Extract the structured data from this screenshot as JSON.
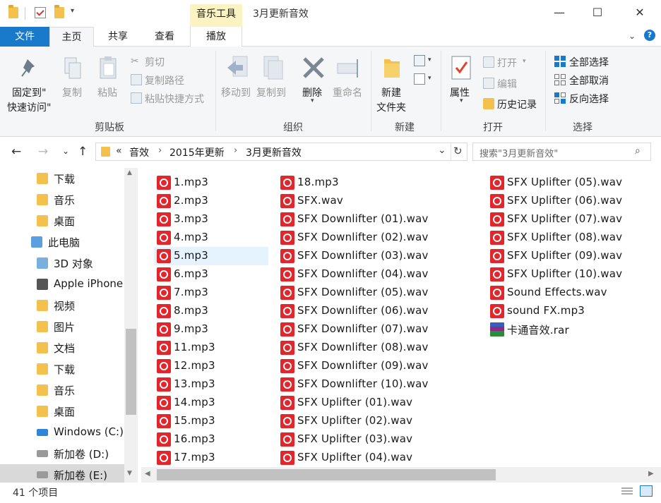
{
  "window": {
    "title": "3月更新音效",
    "context_tab_label": "音乐工具",
    "minimize": "—",
    "maximize": "☐",
    "close": "✕"
  },
  "tabs": {
    "file": "文件",
    "home": "主页",
    "share": "共享",
    "view": "查看",
    "play": "播放"
  },
  "ribbon": {
    "clipboard": {
      "label": "剪贴板",
      "pin_line1": "固定到\"",
      "pin_line2": "快速访问\"",
      "copy": "复制",
      "paste": "粘贴",
      "cut": "剪切",
      "copy_path": "复制路径",
      "paste_shortcut": "粘贴快捷方式"
    },
    "organize": {
      "label": "组织",
      "move_to": "移动到",
      "copy_to": "复制到",
      "delete": "删除",
      "rename": "重命名"
    },
    "new": {
      "label": "新建",
      "new_folder_line1": "新建",
      "new_folder_line2": "文件夹"
    },
    "open": {
      "label": "打开",
      "properties": "属性",
      "open": "打开",
      "edit": "编辑",
      "history": "历史记录"
    },
    "select": {
      "label": "选择",
      "select_all": "全部选择",
      "select_none": "全部取消",
      "invert": "反向选择"
    }
  },
  "address": {
    "overflow": "«",
    "crumbs": [
      "音效",
      "2015年更新",
      "3月更新音效"
    ],
    "search_placeholder": "搜索\"3月更新音效\""
  },
  "nav_pane": [
    {
      "label": "下载",
      "icon": "download-folder-icon",
      "indent": 1
    },
    {
      "label": "音乐",
      "icon": "music-folder-icon",
      "indent": 1
    },
    {
      "label": "桌面",
      "icon": "desktop-folder-icon",
      "indent": 1
    },
    {
      "label": "此电脑",
      "icon": "computer-icon",
      "indent": 0
    },
    {
      "label": "3D 对象",
      "icon": "3d-objects-icon",
      "indent": 1
    },
    {
      "label": "Apple iPhone",
      "icon": "phone-icon",
      "indent": 1
    },
    {
      "label": "视频",
      "icon": "video-folder-icon",
      "indent": 1
    },
    {
      "label": "图片",
      "icon": "pictures-folder-icon",
      "indent": 1
    },
    {
      "label": "文档",
      "icon": "documents-folder-icon",
      "indent": 1
    },
    {
      "label": "下载",
      "icon": "download-folder-icon",
      "indent": 1
    },
    {
      "label": "音乐",
      "icon": "music-folder-icon",
      "indent": 1
    },
    {
      "label": "桌面",
      "icon": "desktop-folder-icon",
      "indent": 1
    },
    {
      "label": "Windows (C:)",
      "icon": "windows-drive-icon",
      "indent": 1
    },
    {
      "label": "新加卷 (D:)",
      "icon": "drive-icon",
      "indent": 1
    },
    {
      "label": "新加卷 (E:)",
      "icon": "drive-icon",
      "indent": 1
    }
  ],
  "files": {
    "col1": [
      "1.mp3",
      "2.mp3",
      "3.mp3",
      "4.mp3",
      "5.mp3",
      "6.mp3",
      "7.mp3",
      "8.mp3",
      "9.mp3",
      "11.mp3",
      "12.mp3",
      "13.mp3",
      "14.mp3",
      "15.mp3",
      "16.mp3",
      "17.mp3"
    ],
    "col2": [
      "18.mp3",
      "SFX.wav",
      "SFX Downlifter (01).wav",
      "SFX Downlifter (02).wav",
      "SFX Downlifter (03).wav",
      "SFX Downlifter (04).wav",
      "SFX Downlifter (05).wav",
      "SFX Downlifter (06).wav",
      "SFX Downlifter (07).wav",
      "SFX Downlifter (08).wav",
      "SFX Downlifter (09).wav",
      "SFX Downlifter (10).wav",
      "SFX Uplifter (01).wav",
      "SFX Uplifter (02).wav",
      "SFX Uplifter (03).wav",
      "SFX Uplifter (04).wav"
    ],
    "col3": [
      "SFX Uplifter (05).wav",
      "SFX Uplifter (06).wav",
      "SFX Uplifter (07).wav",
      "SFX Uplifter (08).wav",
      "SFX Uplifter (09).wav",
      "SFX Uplifter (10).wav",
      "Sound Effects.wav",
      "sound FX.mp3",
      "卡通音效.rar"
    ],
    "selected": "5.mp3"
  },
  "status": {
    "count": "41 个项目"
  },
  "colors": {
    "accent": "#1979ca",
    "context_tab": "#fcf3c2",
    "selection": "#e5f3ff",
    "audio_icon": "#e3262b"
  }
}
